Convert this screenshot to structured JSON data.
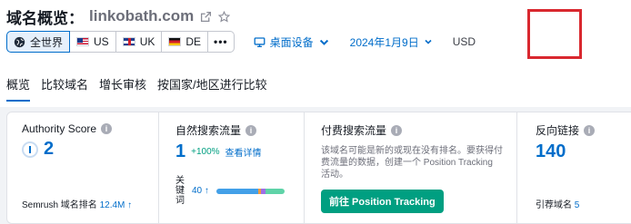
{
  "header": {
    "title_prefix": "域名概览：",
    "domain": "linkobath.com"
  },
  "filters": {
    "locations": [
      {
        "label": "全世界",
        "icon": "globe-icon",
        "active": true
      },
      {
        "label": "US",
        "icon": "flag-us-icon"
      },
      {
        "label": "UK",
        "icon": "flag-uk-icon"
      },
      {
        "label": "DE",
        "icon": "flag-de-icon"
      }
    ],
    "more_label": "•••",
    "device": "桌面设备",
    "date": "2024年1月9日",
    "currency": "USD"
  },
  "tabs": [
    {
      "label": "概览",
      "active": true
    },
    {
      "label": "比较域名"
    },
    {
      "label": "增长审核"
    },
    {
      "label": "按国家/地区进行比较"
    }
  ],
  "metrics": {
    "authority": {
      "title": "Authority Score",
      "value": "2",
      "rank_label": "Semrush 域名排名",
      "rank_value": "12.4M",
      "rank_arrow": "↑"
    },
    "organic": {
      "title": "自然搜索流量",
      "value": "1",
      "change": "+100%",
      "details_link": "查看详情",
      "keywords_label": "关键词",
      "keywords_value": "40",
      "keywords_arrow": "↑",
      "bar_segments": [
        {
          "color": "#43a0e8",
          "share": 0.62
        },
        {
          "color": "#f19a3e",
          "share": 0.04
        },
        {
          "color": "#9f6ee6",
          "share": 0.06
        },
        {
          "color": "#5fd3a8",
          "share": 0.28
        }
      ]
    },
    "paid": {
      "title": "付费搜索流量",
      "description": "该域名可能是新的或现在没有排名。要获得付费流量的数据，创建一个 Position Tracking 活动。",
      "button": "前往 Position Tracking"
    },
    "backlinks": {
      "title": "反向链接",
      "value": "140",
      "ref_domains_label": "引荐域名",
      "ref_domains_value": "5"
    }
  },
  "colors": {
    "accent": "#006dca",
    "success": "#009f81",
    "highlight": "#d9282f"
  }
}
